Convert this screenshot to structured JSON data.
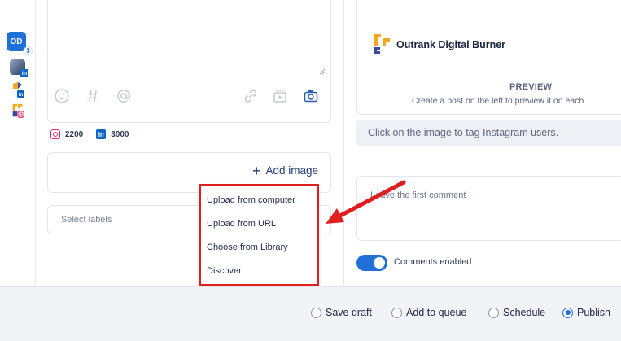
{
  "colors": {
    "accent": "#1f6fd9",
    "highlight": "#e01e1e",
    "instagram": "#e1306c",
    "linkedin": "#0a66c2"
  },
  "accounts": {
    "primary_initials": "OD",
    "primary_count": "3",
    "linkedin_glyph": "in"
  },
  "editor": {
    "toolbar_icons": [
      "emoji-icon",
      "hashtag-icon",
      "mention-icon",
      "link-icon",
      "video-icon",
      "camera-icon"
    ],
    "counts": {
      "instagram": "2200",
      "linkedin": "3000"
    }
  },
  "add_image": {
    "label": "Add image",
    "plus": "+"
  },
  "image_menu": {
    "items": [
      "Upload from computer",
      "Upload from URL",
      "Choose from Library",
      "Discover"
    ]
  },
  "labels": {
    "placeholder": "Select labels"
  },
  "preview": {
    "brand_name": "Outrank Digital Burner",
    "title": "PREVIEW",
    "subtitle": "Create a post on the left to preview it on each"
  },
  "tag_hint": "Click on the image to tag Instagram users.",
  "comment": {
    "placeholder": "Leave the first comment"
  },
  "comments_toggle": {
    "label": "Comments enabled",
    "enabled": true
  },
  "publish_options": {
    "items": [
      {
        "label": "Save draft",
        "selected": false
      },
      {
        "label": "Add to queue",
        "selected": false
      },
      {
        "label": "Schedule",
        "selected": false
      },
      {
        "label": "Publish",
        "selected": true
      }
    ]
  }
}
